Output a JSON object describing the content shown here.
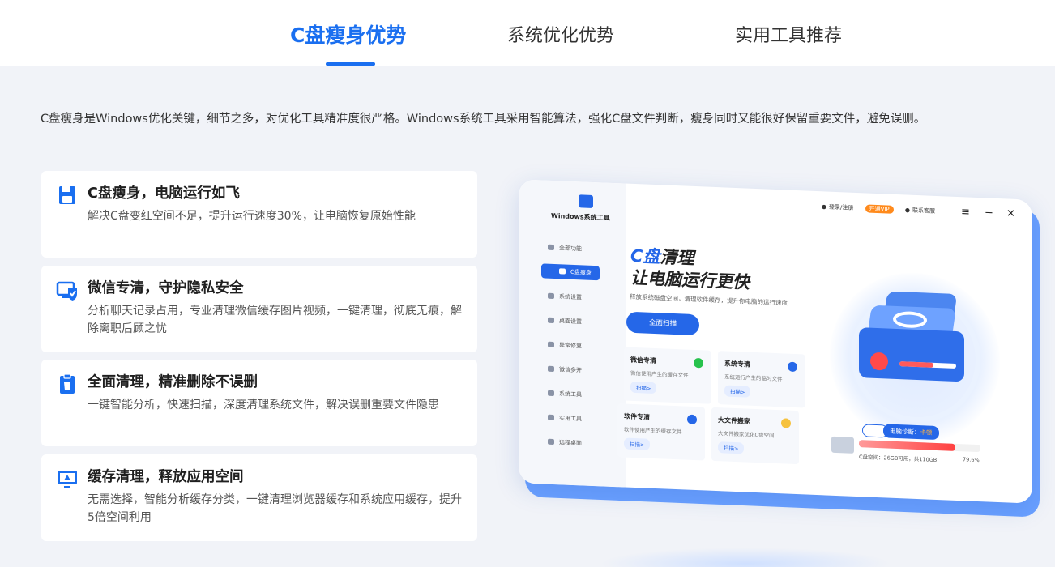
{
  "tabs": [
    {
      "label": "C盘瘦身优势",
      "active": true
    },
    {
      "label": "系统优化优势",
      "active": false
    },
    {
      "label": "实用工具推荐",
      "active": false
    }
  ],
  "intro": "C盘瘦身是Windows优化关键，细节之多，对优化工具精准度很严格。Windows系统工具采用智能算法，强化C盘文件判断，瘦身同时又能很好保留重要文件，避免误删。",
  "features": [
    {
      "icon": "save-disk-icon",
      "title": "C盘瘦身，电脑运行如飞",
      "desc": "解决C盘变红空间不足，提升运行速度30%，让电脑恢复原始性能"
    },
    {
      "icon": "wechat-shield-icon",
      "title": "微信专清，守护隐私安全",
      "desc": "分析聊天记录占用，专业清理微信缓存图片视频，一键清理，彻底无痕，解除离职后顾之忧"
    },
    {
      "icon": "clipboard-clean-icon",
      "title": "全面清理，精准删除不误删",
      "desc": "一键智能分析，快速扫描，深度清理系统文件，解决误删重要文件隐患"
    },
    {
      "icon": "monitor-cache-icon",
      "title": "缓存清理，释放应用空间",
      "desc": "无需选择，智能分析缓存分类，一键清理浏览器缓存和系统应用缓存，提升5倍空间利用"
    }
  ],
  "mock": {
    "app_name": "Windows系统工具",
    "topbar": {
      "login": "登录/注册",
      "vip": "开通VIP",
      "service": "联系客服"
    },
    "controls": [
      "≡",
      "−",
      "✕"
    ],
    "sidebar": [
      "全部功能",
      "C盘瘦身",
      "系统设置",
      "桌面设置",
      "异常修复",
      "微信多开",
      "系统工具",
      "实用工具",
      "远程桌面"
    ],
    "title_c": "C盘",
    "title_rest": "清理",
    "title_line2": "让电脑运行更快",
    "slogan": "释放系统磁盘空间，清理软件缓存，提升你电脑的运行速度",
    "scan_button": "全面扫描",
    "cards": [
      {
        "title": "微信专清",
        "desc": "微信使用产生的缓存文件",
        "action": "扫描>",
        "color": "#27c24c"
      },
      {
        "title": "系统专清",
        "desc": "系统运行产生的临时文件",
        "action": "扫描>",
        "color": "#2567e8"
      },
      {
        "title": "软件专清",
        "desc": "软件使用产生的缓存文件",
        "action": "扫描>",
        "color": "#2567e8"
      },
      {
        "title": "大文件搬家",
        "desc": "大文件搬家优化C盘空间",
        "action": "扫描>",
        "color": "#f6c23e"
      }
    ],
    "diagnosis_label": "电脑诊断：",
    "diagnosis_value": "卡顿",
    "usage_text": "C盘空间：26GB可用，共110GB",
    "usage_pct": "79.6%",
    "usage_fraction": 0.796
  },
  "colors": {
    "accent": "#1a6ff0",
    "background": "#f1f3f8",
    "warn": "#ff4a4a"
  }
}
